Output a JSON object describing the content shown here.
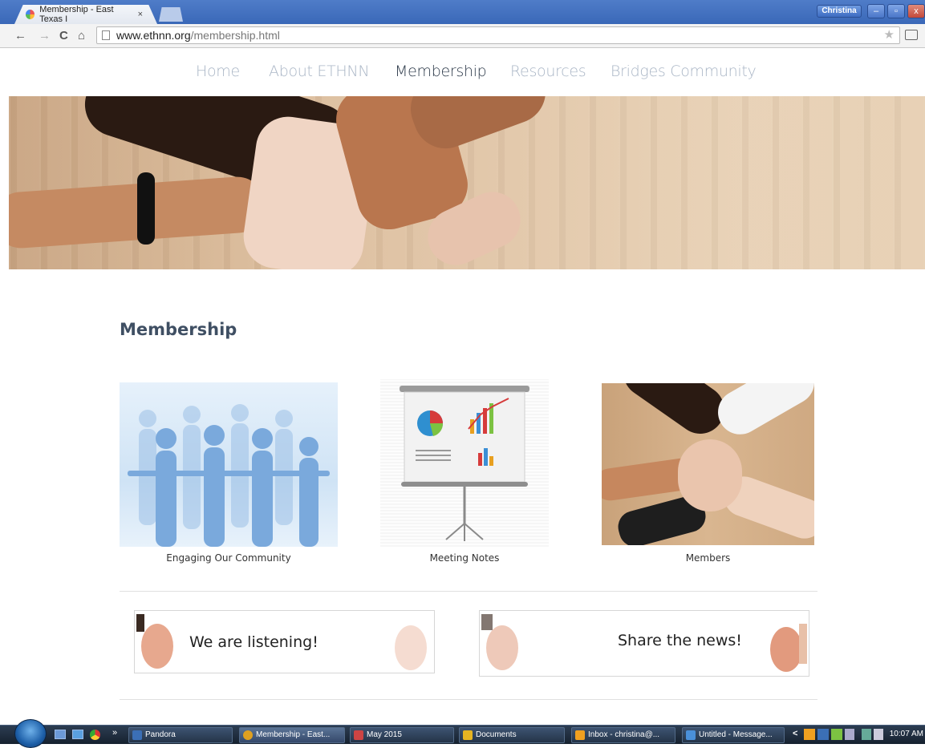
{
  "browser": {
    "tab_title": "Membership - East Texas I",
    "tab_close": "×",
    "user": "Christina",
    "window_min": "–",
    "window_max": "▫",
    "window_close": "x",
    "url_host": "www.ethnn.org",
    "url_path": "/membership.html",
    "back": "←",
    "forward": "→",
    "reload": "C",
    "home": "⌂",
    "star": "★",
    "menu": "⋮"
  },
  "nav": {
    "items": [
      {
        "label": "Home",
        "active": false
      },
      {
        "label": "About ETHNN",
        "active": false
      },
      {
        "label": "Membership",
        "active": true
      },
      {
        "label": "Resources",
        "active": false
      },
      {
        "label": "Bridges Community",
        "active": false
      }
    ]
  },
  "page": {
    "title": "Membership"
  },
  "cards": [
    {
      "label": "Engaging Our Community"
    },
    {
      "label": "Meeting Notes"
    },
    {
      "label": "Members"
    }
  ],
  "banners": [
    {
      "text": "We are listening!"
    },
    {
      "text": "Share the news!"
    }
  ],
  "taskbar": {
    "items": [
      {
        "label": "Pandora",
        "color": "#3b6fb6"
      },
      {
        "label": "Membership - East...",
        "color": "#e0a020"
      },
      {
        "label": "May 2015",
        "color": "#cc4444"
      },
      {
        "label": "Documents",
        "color": "#e6b422"
      },
      {
        "label": "Inbox - christina@...",
        "color": "#f0a020"
      },
      {
        "label": "Untitled - Message...",
        "color": "#4a90d9"
      }
    ],
    "overflow": "»",
    "tray_arrow": "<",
    "time": "10:07 AM"
  }
}
